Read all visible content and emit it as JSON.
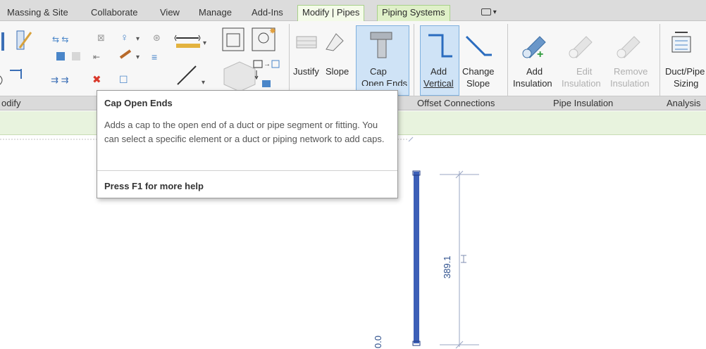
{
  "tabs": [
    {
      "label": "Massing & Site"
    },
    {
      "label": "Collaborate"
    },
    {
      "label": "View"
    },
    {
      "label": "Manage"
    },
    {
      "label": "Add-Ins"
    },
    {
      "label": "Modify | Pipes"
    },
    {
      "label": "Piping Systems"
    }
  ],
  "ribbon": {
    "buttons": {
      "justify": "Justify",
      "slope": "Slope",
      "cap_line1": "Cap",
      "cap_line2": "Open Ends",
      "add_vertical_line1": "Add",
      "add_vertical_line2": "Vertical",
      "change_slope_line1": "Change",
      "change_slope_line2": "Slope",
      "add_insulation_line1": "Add",
      "add_insulation_line2": "Insulation",
      "edit_insulation_line1": "Edit",
      "edit_insulation_line2": "Insulation",
      "remove_insulation_line1": "Remove",
      "remove_insulation_line2": "Insulation",
      "duct_sizing_line1": "Duct/Pipe",
      "duct_sizing_line2": "Sizing"
    },
    "panels": {
      "modify": "odify",
      "offset_connections": "Offset Connections",
      "pipe_insulation": "Pipe Insulation",
      "analysis": "Analysis"
    }
  },
  "tooltip": {
    "title": "Cap Open Ends",
    "body": "Adds a cap to the open end of a duct or pipe segment or fitting. You can select a specific element or a duct or piping network to add caps.",
    "help": "Press F1 for more help"
  },
  "drawing": {
    "dimension_value": "389.1",
    "bottom_value": "0.0"
  },
  "colors": {
    "context_tab_bg": "#dff0c8",
    "pipe_blue": "#3c5fb8",
    "selected_button_bg": "#cfe3f6"
  }
}
